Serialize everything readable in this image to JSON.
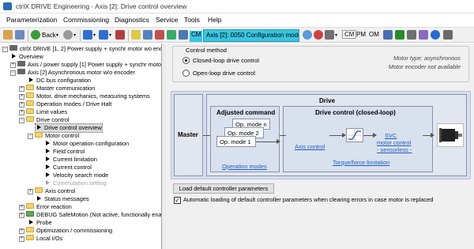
{
  "window": {
    "title": "ctrlX DRIVE Engineering - Axis [2]: Drive control overview"
  },
  "menu": [
    "Parameterization",
    "Commissioning",
    "Diagnostics",
    "Service",
    "Tools",
    "Help"
  ],
  "toolbar": {
    "back_label": "Back",
    "cm_badge": "CM",
    "axis_value": "Axis [2]:  0050 Configuration mode",
    "mode_tags": [
      "CM",
      "PM",
      "OM"
    ]
  },
  "tree": {
    "items": [
      "ctrlX DRIVE [1, 2] Power supply + synchr motor wo enc /",
      "Overview",
      "Axis / power supply [1] Power supply + synchr motor",
      "Axis [2] Asynchronous motor w/o encoder",
      "DC bus configuration",
      "Master communication",
      "Motor, drive mechanics, measuring systems",
      "Operation modes / Drive Halt",
      "Limit values",
      "Drive control",
      "Drive control overview",
      "Motor control",
      "Motor operation configuration",
      "Field control",
      "Current limitation",
      "Current control",
      "Velocity search mode",
      "Commutation setting",
      "Axis control",
      "Status messages",
      "Error reaction",
      "DEBUG SafeMotion (Not active, functionally ena",
      "Probe",
      "Optimization / commissioning",
      "Local I/Os"
    ]
  },
  "control_method": {
    "legend": "Control method",
    "options": [
      "Closed-loop drive control",
      "Open-loop drive control"
    ],
    "selected_index": 0,
    "motor_type": "Motor type: asynchronous",
    "encoder_info": "Motor encoder not available"
  },
  "diagram": {
    "master": "Master",
    "drive": "Drive",
    "adjusted_command": "Adjusted command",
    "op_modes": [
      "Op. mode n",
      "Op. mode 2",
      "Op. mode 1"
    ],
    "operation_modes_link": "Operation modes",
    "drive_control_title": "Drive control (closed-loop)",
    "axis_control_link": "Axis control",
    "svc_link_1": "SVC",
    "svc_link_2": "motor control",
    "svc_link_3": "- sensorless -",
    "torque_link": "Torque/force limitation"
  },
  "buttons": {
    "load_default": "Load default controller parameters"
  },
  "auto_load": {
    "checked": true,
    "label": "Automatic loading of default controller parameters when clearing errors in case motor is replaced"
  },
  "colors": {
    "axis_select_bg": "#38c6e0",
    "diagram_bg": "#d6deef",
    "link": "#1f5fbf"
  }
}
